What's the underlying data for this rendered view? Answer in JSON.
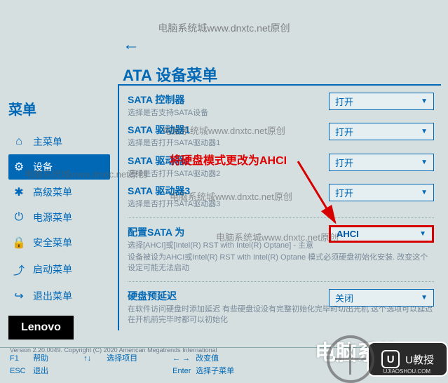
{
  "watermark_text": "电脑系统城www.dnxtc.net原创",
  "page_title": "ATA 设备菜单",
  "sidebar": {
    "title": "菜单",
    "items": [
      {
        "icon": "⌂",
        "label": "主菜单"
      },
      {
        "icon": "⚙",
        "label": "设备"
      },
      {
        "icon": "✱",
        "label": "高级菜单"
      },
      {
        "icon": "⏻",
        "label": "电源菜单"
      },
      {
        "icon": "🔒",
        "label": "安全菜单"
      },
      {
        "icon": "⤴",
        "label": "启动菜单"
      },
      {
        "icon": "↪",
        "label": "退出菜单"
      }
    ]
  },
  "brand": "Lenovo",
  "settings": [
    {
      "label": "SATA 控制器",
      "desc": "选择是否支持SATA设备",
      "value": "打开"
    },
    {
      "label": "SATA 驱动器1",
      "desc": "选择是否打开SATA驱动器1",
      "value": "打开"
    },
    {
      "label": "SATA 驱动器2",
      "desc": "选择是否打开SATA驱动器2",
      "value": "打开"
    },
    {
      "label": "SATA 驱动器3",
      "desc": "选择是否打开SATA驱动器3",
      "value": "打开"
    }
  ],
  "config_sata": {
    "label": "配置SATA 为",
    "desc1": "选择[AHCI]或[Intel(R) RST with Intel(R) Optane] - 主意",
    "desc2": "设备被设为AHCI或Intel(R) RST with Intel(R) Optane 模式必须硬盘初始化安装. 改变这个设定可能无法启动",
    "value": "AHCI"
  },
  "hdd_delay": {
    "label": "硬盘预延迟",
    "desc": "在软件访问硬盘时添加延迟\n有些硬盘设没有完整初始化完毕时切出光机\n这个选项可以延迟在开机前完毕时都可以初始化",
    "value": "关闭"
  },
  "annotation": "将硬盘模式更改为AHCI",
  "footer": {
    "f1": {
      "key": "F1",
      "label": "帮助"
    },
    "esc": {
      "key": "ESC",
      "label": "退出"
    },
    "arrows": {
      "key": "↑↓",
      "label": "选择项目"
    },
    "lr": {
      "key": "← →",
      "label": "改变值"
    },
    "enter": {
      "key": "Enter",
      "label": "选择子菜单"
    }
  },
  "version": "Version 2.20.0049. Copyright (C) 2020 American Megatrends International",
  "wm_badge": {
    "icon": "U",
    "text": "U教授",
    "domain": "UJIAOSHOU.COM"
  },
  "wm_bg_text": "电脑系统"
}
